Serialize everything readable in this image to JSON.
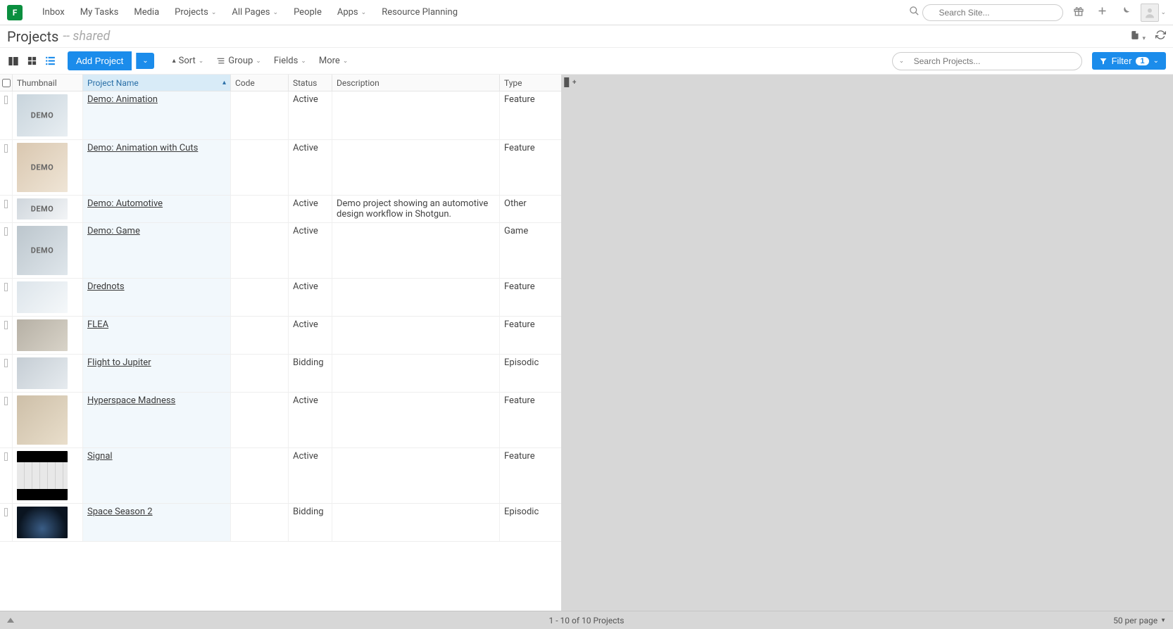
{
  "nav": {
    "logo": "F",
    "links": [
      {
        "label": "Inbox",
        "dropdown": false
      },
      {
        "label": "My Tasks",
        "dropdown": false
      },
      {
        "label": "Media",
        "dropdown": false
      },
      {
        "label": "Projects",
        "dropdown": true
      },
      {
        "label": "All Pages",
        "dropdown": true
      },
      {
        "label": "People",
        "dropdown": false
      },
      {
        "label": "Apps",
        "dropdown": true
      },
      {
        "label": "Resource Planning",
        "dropdown": false
      }
    ],
    "search_placeholder": "Search Site..."
  },
  "page": {
    "title": "Projects",
    "subtitle": "-- shared"
  },
  "toolbar": {
    "add_label": "Add Project",
    "sort_label": "Sort",
    "group_label": "Group",
    "fields_label": "Fields",
    "more_label": "More",
    "search_placeholder": "Search Projects...",
    "filter_label": "Filter",
    "filter_count": "1"
  },
  "columns": {
    "thumbnail": "Thumbnail",
    "project_name": "Project Name",
    "code": "Code",
    "status": "Status",
    "description": "Description",
    "type": "Type"
  },
  "rows": [
    {
      "name": "Demo: Animation",
      "code": "",
      "status": "Active",
      "description": "",
      "type": "Feature",
      "thumb_h": "h-tall",
      "demo": true,
      "tvar": "tvar0"
    },
    {
      "name": "Demo: Animation with Cuts",
      "code": "",
      "status": "Active",
      "description": "",
      "type": "Feature",
      "thumb_h": "h-xl",
      "demo": true,
      "tvar": "tvar1"
    },
    {
      "name": "Demo: Automotive",
      "code": "",
      "status": "Active",
      "description": "Demo project showing an automotive design workflow in Shotgun.",
      "type": "Other",
      "thumb_h": "h-short",
      "demo": true,
      "tvar": "tvar2"
    },
    {
      "name": "Demo: Game",
      "code": "",
      "status": "Active",
      "description": "",
      "type": "Game",
      "thumb_h": "h-xl",
      "demo": true,
      "tvar": "tvar3"
    },
    {
      "name": "Drednots",
      "code": "",
      "status": "Active",
      "description": "",
      "type": "Feature",
      "thumb_h": "h-med",
      "demo": false,
      "tvar": "tvar4"
    },
    {
      "name": "FLEA",
      "code": "",
      "status": "Active",
      "description": "",
      "type": "Feature",
      "thumb_h": "h-med",
      "demo": false,
      "tvar": "tvar5"
    },
    {
      "name": "Flight to Jupiter",
      "code": "",
      "status": "Bidding",
      "description": "",
      "type": "Episodic",
      "thumb_h": "h-med",
      "demo": false,
      "tvar": "tvar6"
    },
    {
      "name": "Hyperspace Madness",
      "code": "",
      "status": "Active",
      "description": "",
      "type": "Feature",
      "thumb_h": "h-xl",
      "demo": false,
      "tvar": "tvar7"
    },
    {
      "name": "Signal",
      "code": "",
      "status": "Active",
      "description": "",
      "type": "Feature",
      "thumb_h": "h-xl",
      "demo": false,
      "tvar": "tvar8"
    },
    {
      "name": "Space Season 2",
      "code": "",
      "status": "Bidding",
      "description": "",
      "type": "Episodic",
      "thumb_h": "h-med",
      "demo": false,
      "tvar": "tvar9"
    }
  ],
  "footer": {
    "range": "1 - 10 of 10 Projects",
    "per_page": "50 per page"
  }
}
